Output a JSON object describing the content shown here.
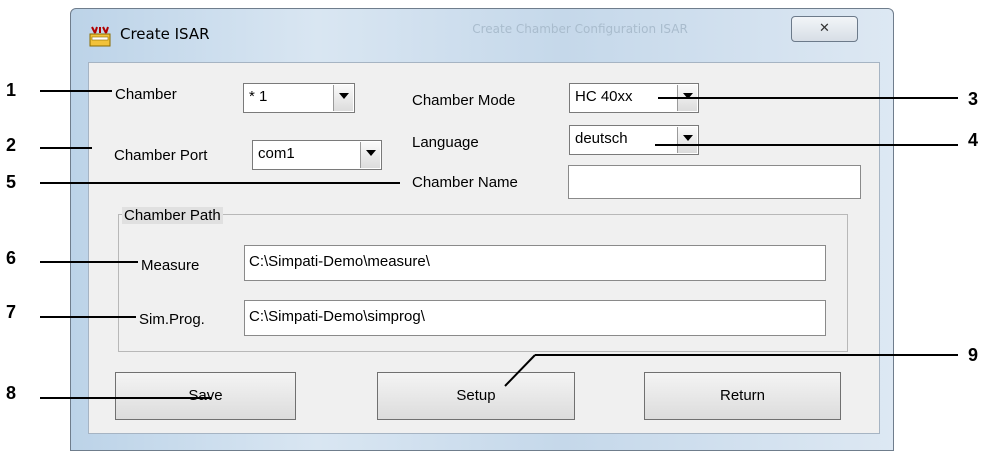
{
  "window": {
    "title": "Create ISAR",
    "background_title": "Create Chamber Configuration ISAR",
    "close_label": "✕"
  },
  "form": {
    "chamber": {
      "label": "Chamber",
      "value": "* 1"
    },
    "chamber_port": {
      "label": "Chamber Port",
      "value": "com1"
    },
    "chamber_mode": {
      "label": "Chamber Mode",
      "value": "HC 40xx"
    },
    "language": {
      "label": "Language",
      "value": "deutsch"
    },
    "chamber_name": {
      "label": "Chamber Name",
      "value": ""
    },
    "chamber_path": {
      "title": "Chamber Path",
      "measure": {
        "label": "Measure",
        "value": "C:\\Simpati-Demo\\measure\\"
      },
      "simprog": {
        "label": "Sim.Prog.",
        "value": "C:\\Simpati-Demo\\simprog\\"
      }
    }
  },
  "buttons": {
    "save": "Save",
    "setup": "Setup",
    "return": "Return"
  },
  "callouts": [
    "1",
    "2",
    "3",
    "4",
    "5",
    "6",
    "7",
    "8",
    "9"
  ],
  "colors": {
    "accent": "#bcd3e8",
    "client": "#f0f0f0"
  }
}
